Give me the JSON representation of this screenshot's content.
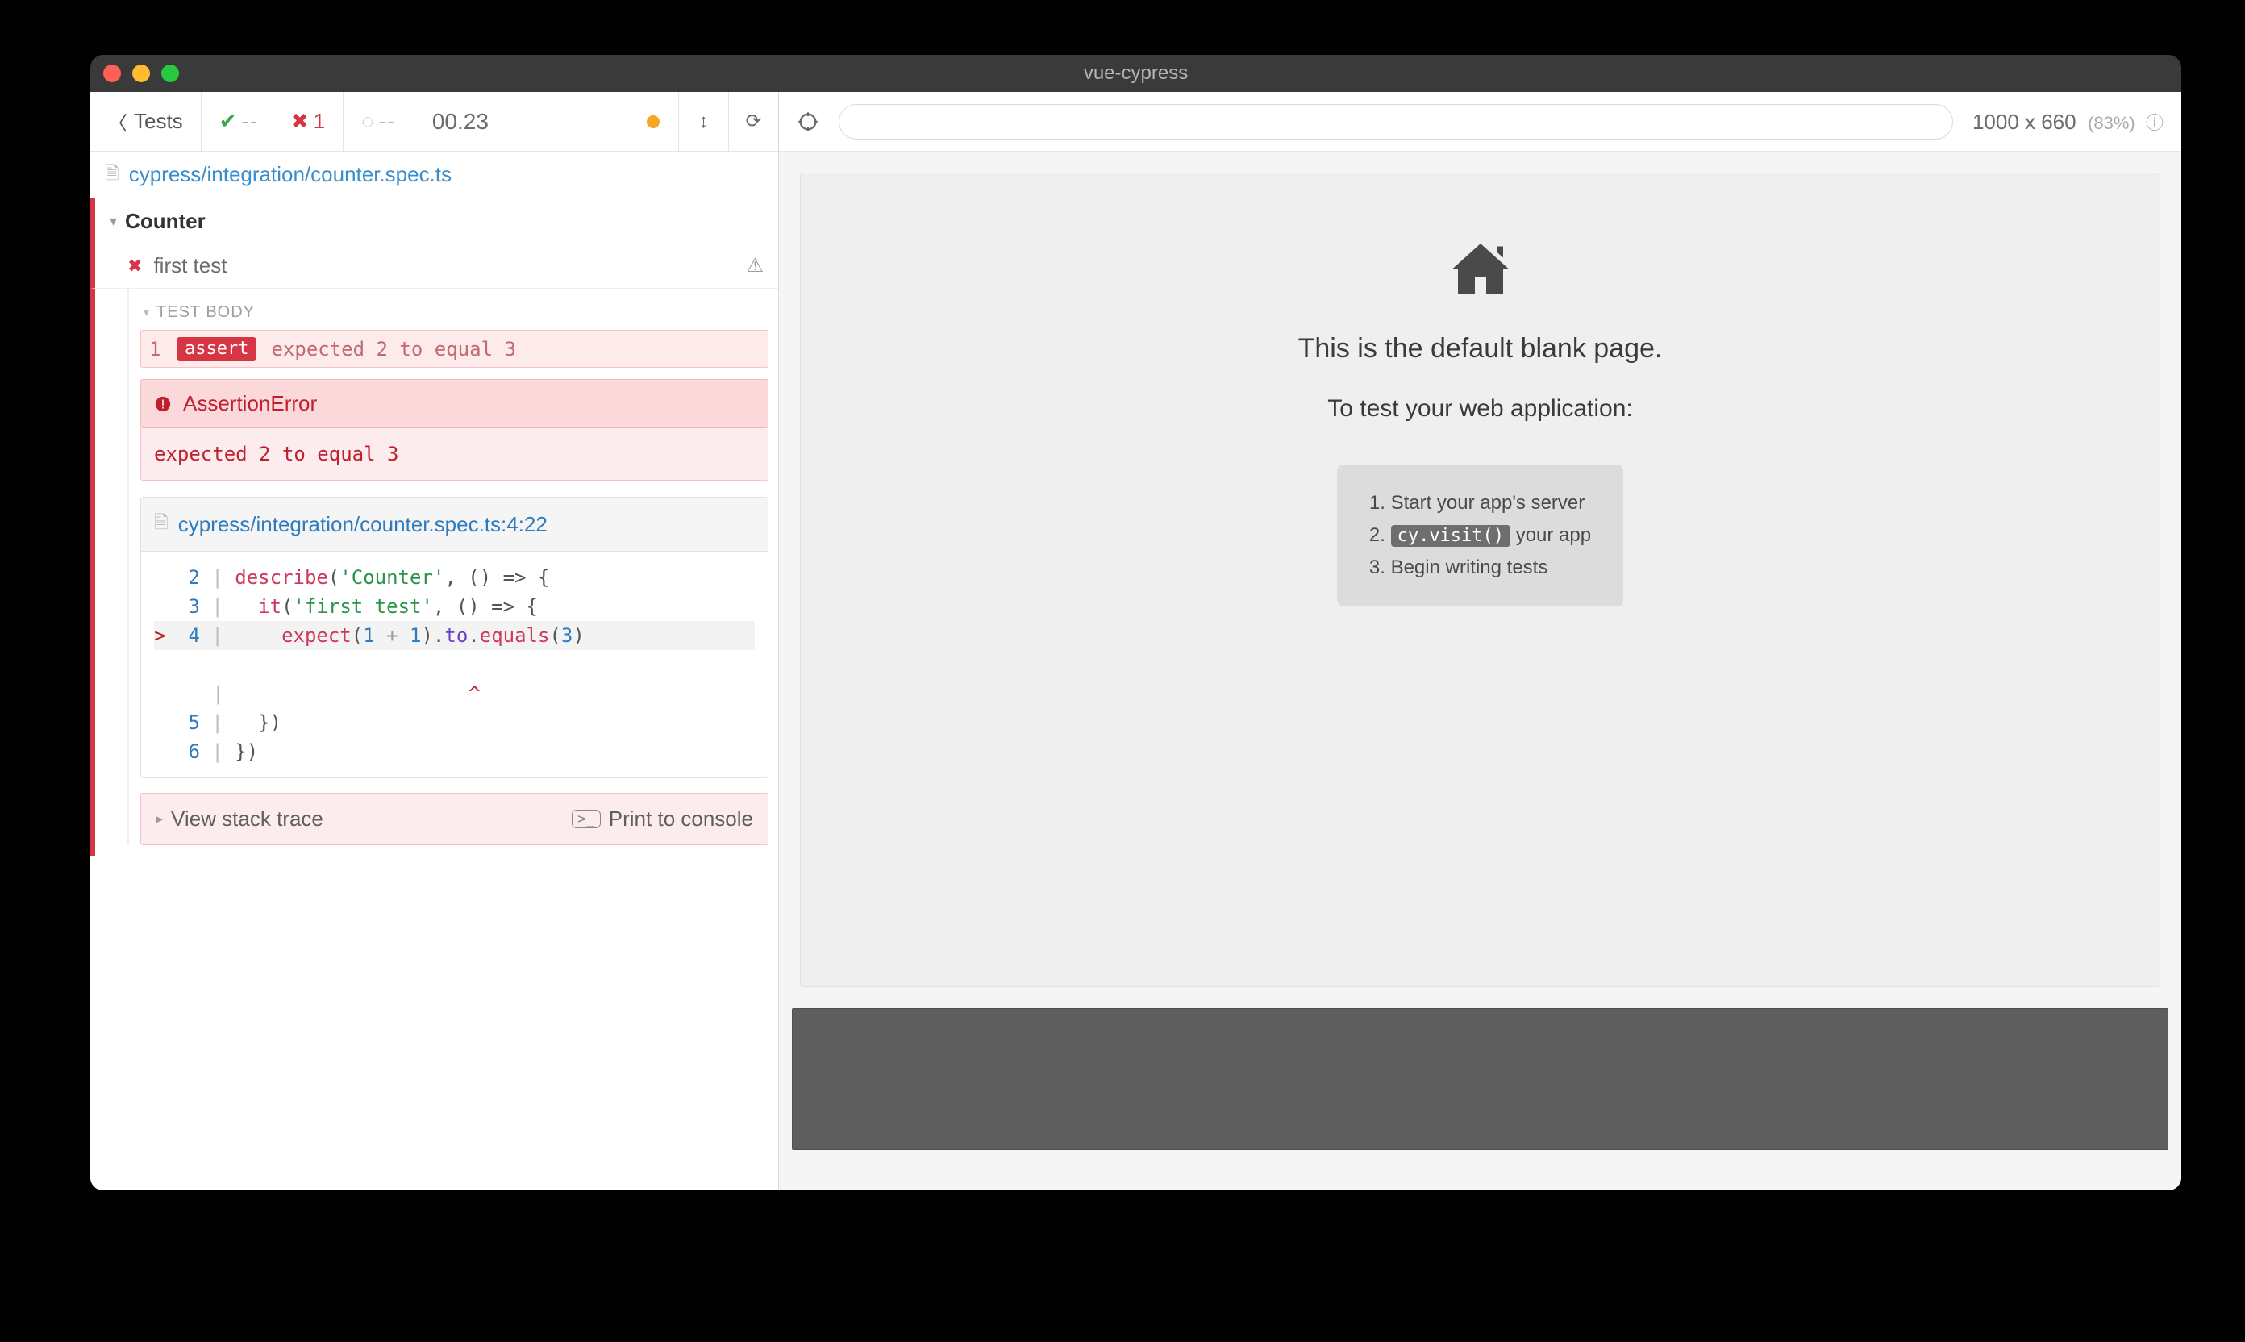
{
  "window": {
    "title": "vue-cypress"
  },
  "toolbar": {
    "tests_label": "Tests",
    "passed": "--",
    "failed": "1",
    "pending": "--",
    "duration": "00.23"
  },
  "spec_file": "cypress/integration/counter.spec.ts",
  "suite": {
    "name": "Counter"
  },
  "test": {
    "name": "first test"
  },
  "body_label": "TEST BODY",
  "assert": {
    "index": "1",
    "badge": "assert",
    "message": "expected 2 to equal 3"
  },
  "error": {
    "title": "AssertionError",
    "message": "expected 2 to equal 3",
    "source_link": "cypress/integration/counter.spec.ts:4:22",
    "view_stack": "View stack trace",
    "print_console": "Print to console"
  },
  "source": {
    "l2": {
      "n": "2",
      "code_a": "describe",
      "code_b": "'Counter'",
      "code_c": ", () => {"
    },
    "l3": {
      "n": "3",
      "code_a": "it",
      "code_b": "'first test'",
      "code_c": ", () => {"
    },
    "l4": {
      "n": "4",
      "code_a": "expect",
      "code_b": "(",
      "code_c": "1",
      "code_d": "+",
      "code_e": "1",
      "code_f": ").",
      "code_g": "to",
      "code_h": ".",
      "code_i": "equals",
      "code_j": "(",
      "code_k": "3",
      "code_l": ")",
      "arrow": ">"
    },
    "caret": {
      "pad": "                     ",
      "sym": "^"
    },
    "l5": {
      "n": "5",
      "code": "  })"
    },
    "l6": {
      "n": "6",
      "code": "})"
    }
  },
  "viewport": {
    "dims": "1000 x 660",
    "pct": "(83%)"
  },
  "aut": {
    "h1": "This is the default blank page.",
    "h2": "To test your web application:",
    "steps": {
      "s1": "Start your app's server",
      "s2_code": "cy.visit()",
      "s2_tail": " your app",
      "s3": "Begin writing tests"
    }
  }
}
